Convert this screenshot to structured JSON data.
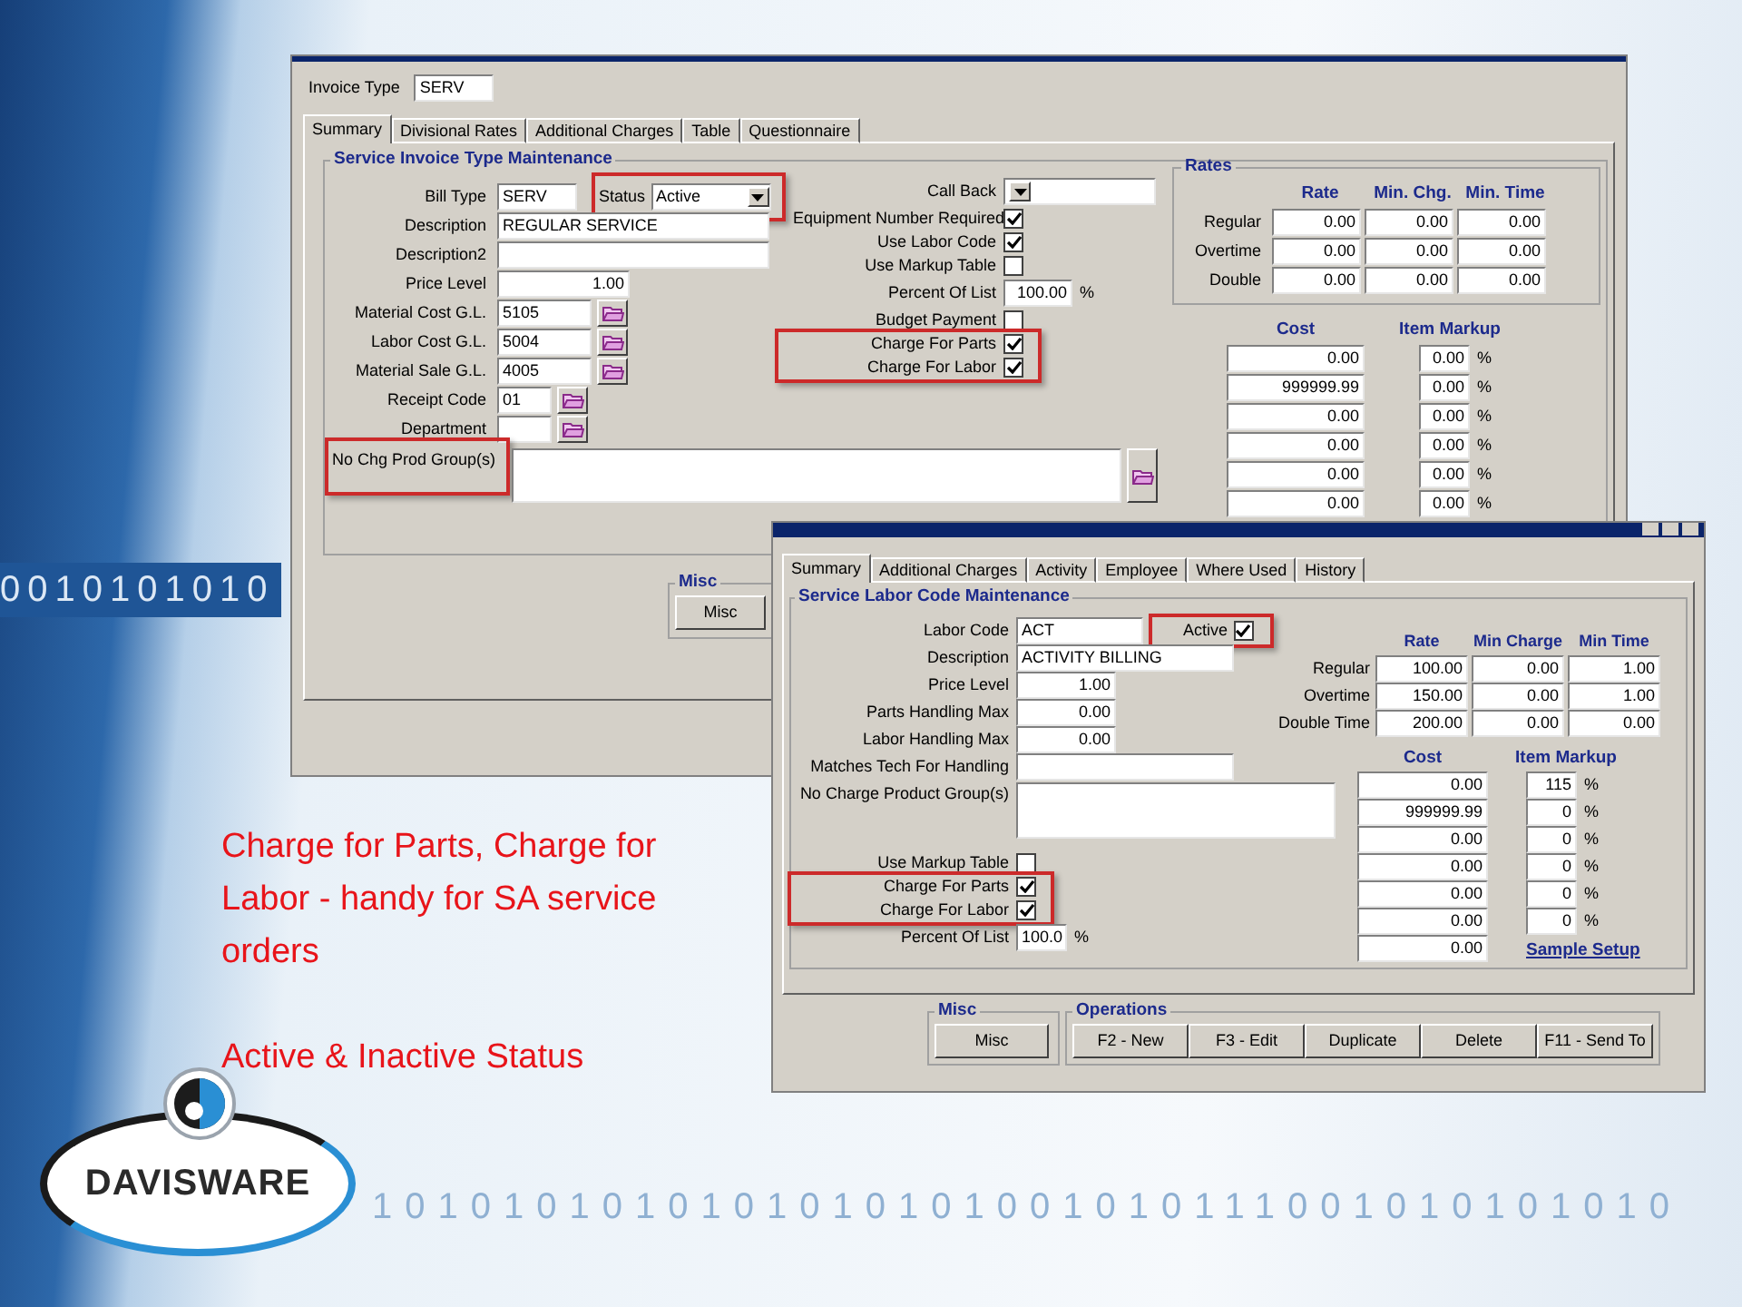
{
  "slide": {
    "background_digits": [
      "0010101010",
      "1010101010101010101001010111001010101010"
    ],
    "notes": [
      "Charge for Parts, Charge for Labor  -  handy for SA service orders",
      "Active & Inactive Status"
    ],
    "logo": "DAVISWARE"
  },
  "invoice_window": {
    "invoice_type": {
      "label": "Invoice Type",
      "value": "SERV"
    },
    "tabs": [
      {
        "label": "Summary",
        "selected": true
      },
      {
        "label": "Divisional Rates",
        "selected": false
      },
      {
        "label": "Additional Charges",
        "selected": false
      },
      {
        "label": "Table",
        "selected": false
      },
      {
        "label": "Questionnaire",
        "selected": false
      }
    ],
    "group_title": "Service Invoice Type Maintenance",
    "fields": [
      {
        "label": "Bill Type",
        "value": "SERV",
        "kind": "code",
        "status": {
          "label": "Status",
          "value": "Active",
          "highlighted": true
        }
      },
      {
        "label": "Description",
        "value": "REGULAR SERVICE",
        "kind": "text"
      },
      {
        "label": "Description2",
        "kind": "text"
      },
      {
        "label": "Price Level",
        "value": "1.00",
        "kind": "number"
      },
      {
        "label": "Material Cost G.L.",
        "value": "5105",
        "kind": "lookup"
      },
      {
        "label": "Labor Cost G.L.",
        "value": "5004",
        "kind": "lookup"
      },
      {
        "label": "Material Sale G.L.",
        "value": "4005",
        "kind": "lookup"
      },
      {
        "label": "Receipt Code",
        "value": "01",
        "kind": "short-lookup"
      },
      {
        "label": "Department",
        "kind": "short-lookup"
      }
    ],
    "product_groups": {
      "label": "No Chg Prod Group(s)",
      "highlighted": true
    },
    "options": [
      {
        "label": "Call Back",
        "kind": "dropdown",
        "highlighted": false
      },
      {
        "label": "Equipment Number Required",
        "kind": "checkbox",
        "checked": true,
        "highlighted": false
      },
      {
        "label": "Use Labor Code",
        "kind": "checkbox",
        "checked": true,
        "highlighted": false
      },
      {
        "label": "Use Markup Table",
        "kind": "checkbox",
        "checked": false,
        "highlighted": false
      },
      {
        "label": "Percent Of List",
        "kind": "percent",
        "value": "100.00",
        "unit": "%",
        "highlighted": false
      },
      {
        "label": "Budget Payment",
        "kind": "checkbox",
        "checked": false,
        "highlighted": false
      },
      {
        "label": "Charge For Parts",
        "kind": "checkbox",
        "checked": true,
        "highlighted": true
      },
      {
        "label": "Charge For Labor",
        "kind": "checkbox",
        "checked": true,
        "highlighted": true
      }
    ],
    "rates": {
      "title": "Rates",
      "columns": [
        "Rate",
        "Min. Chg.",
        "Min. Time"
      ],
      "rows": [
        {
          "label": "Regular",
          "values": [
            "0.00",
            "0.00",
            "0.00"
          ]
        },
        {
          "label": "Overtime",
          "values": [
            "0.00",
            "0.00",
            "0.00"
          ]
        },
        {
          "label": "Double",
          "values": [
            "0.00",
            "0.00",
            "0.00"
          ]
        }
      ]
    },
    "markup": {
      "columns": [
        "Cost",
        "Item Markup"
      ],
      "rows": [
        {
          "cost": "0.00",
          "markup": "0.00",
          "unit": "%"
        },
        {
          "cost": "999999.99",
          "markup": "0.00",
          "unit": "%"
        },
        {
          "cost": "0.00",
          "markup": "0.00",
          "unit": "%"
        },
        {
          "cost": "0.00",
          "markup": "0.00",
          "unit": "%"
        },
        {
          "cost": "0.00",
          "markup": "0.00",
          "unit": "%"
        },
        {
          "cost": "0.00",
          "markup": "0.00",
          "unit": "%"
        }
      ]
    },
    "misc": {
      "title": "Misc",
      "button": "Misc"
    }
  },
  "labor_window": {
    "tabs": [
      {
        "label": "Summary",
        "selected": true
      },
      {
        "label": "Additional Charges",
        "selected": false
      },
      {
        "label": "Activity",
        "selected": false
      },
      {
        "label": "Employee",
        "selected": false
      },
      {
        "label": "Where Used",
        "selected": false
      },
      {
        "label": "History",
        "selected": false
      }
    ],
    "group_title": "Service Labor Code Maintenance",
    "labor_code": {
      "label": "Labor Code",
      "value": "ACT",
      "active": {
        "label": "Active",
        "checked": true,
        "highlighted": true
      }
    },
    "fields": [
      {
        "label": "Description",
        "value": "ACTIVITY BILLING",
        "kind": "text"
      },
      {
        "label": "Price Level",
        "value": "1.00",
        "kind": "number"
      },
      {
        "label": "Parts Handling Max",
        "value": "0.00",
        "kind": "number"
      },
      {
        "label": "Labor Handling Max",
        "value": "0.00",
        "kind": "number"
      },
      {
        "label": "Matches Tech For Handling",
        "kind": "text"
      },
      {
        "label": "No Charge Product Group(s)",
        "kind": "multiline"
      }
    ],
    "options": [
      {
        "label": "Use Markup Table",
        "kind": "checkbox",
        "checked": false,
        "highlighted": false
      },
      {
        "label": "Charge For Parts",
        "kind": "checkbox",
        "checked": true,
        "highlighted": true
      },
      {
        "label": "Charge For Labor",
        "kind": "checkbox",
        "checked": true,
        "highlighted": true
      },
      {
        "label": "Percent Of List",
        "kind": "percent",
        "value": "100.0",
        "unit": "%",
        "highlighted": false
      }
    ],
    "rates": {
      "columns": [
        "Rate",
        "Min Charge",
        "Min Time"
      ],
      "rows": [
        {
          "label": "Regular",
          "values": [
            "100.00",
            "0.00",
            "1.00"
          ]
        },
        {
          "label": "Overtime",
          "values": [
            "150.00",
            "0.00",
            "1.00"
          ]
        },
        {
          "label": "Double Time",
          "values": [
            "200.00",
            "0.00",
            "0.00"
          ]
        }
      ]
    },
    "markup": {
      "columns": [
        "Cost",
        "Item Markup"
      ],
      "rows": [
        {
          "cost": "0.00",
          "markup": "115",
          "unit": "%"
        },
        {
          "cost": "999999.99",
          "markup": "0",
          "unit": "%"
        },
        {
          "cost": "0.00",
          "markup": "0",
          "unit": "%"
        },
        {
          "cost": "0.00",
          "markup": "0",
          "unit": "%"
        },
        {
          "cost": "0.00",
          "markup": "0",
          "unit": "%"
        },
        {
          "cost": "0.00",
          "markup": "0",
          "unit": "%"
        },
        {
          "cost": "0.00"
        }
      ]
    },
    "link": "Sample Setup",
    "misc": {
      "title": "Misc",
      "button": "Misc"
    },
    "operations": {
      "title": "Operations",
      "buttons": [
        "F2 - New",
        "F3 - Edit",
        "Duplicate",
        "Delete",
        "F11 - Send To"
      ]
    }
  }
}
